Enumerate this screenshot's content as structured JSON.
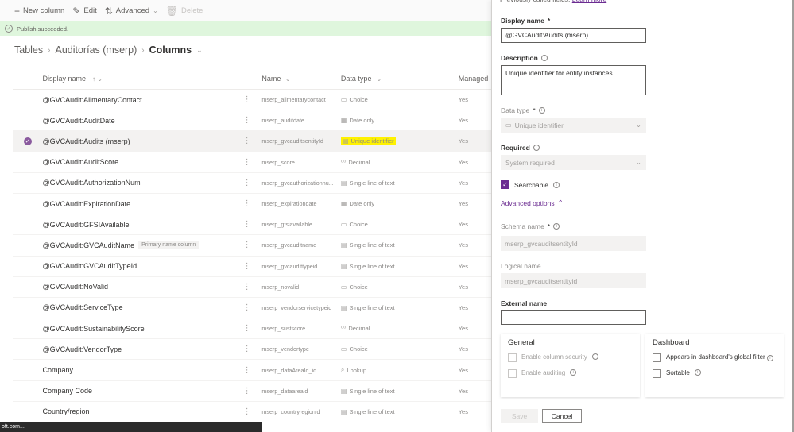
{
  "toolbar": {
    "new_column": "New column",
    "edit": "Edit",
    "advanced": "Advanced",
    "delete": "Delete"
  },
  "message": {
    "text": "Publish succeeded."
  },
  "breadcrumb": {
    "tables": "Tables",
    "table": "Auditorías (mserp)",
    "current": "Columns"
  },
  "grid": {
    "headers": {
      "display_name": "Display name",
      "name": "Name",
      "data_type": "Data type",
      "managed": "Managed"
    },
    "rows": [
      {
        "display": "@GVCAudit:AlimentaryContact",
        "name": "mserp_alimentarycontact",
        "type": "Choice",
        "type_icon": "choice-icon",
        "managed": "Yes"
      },
      {
        "display": "@GVCAudit:AuditDate",
        "name": "mserp_auditdate",
        "type": "Date only",
        "type_icon": "calendar-icon",
        "managed": "Yes"
      },
      {
        "display": "@GVCAudit:Audits (mserp)",
        "name": "mserp_gvcauditsentityId",
        "type": "Unique identifier",
        "type_icon": "id-icon",
        "managed": "Yes",
        "selected": true,
        "highlighted": true
      },
      {
        "display": "@GVCAudit:AuditScore",
        "name": "mserp_score",
        "type": "Decimal",
        "type_icon": "decimal-icon",
        "managed": "Yes"
      },
      {
        "display": "@GVCAudit:AuthorizationNum",
        "name": "mserp_gvcauthorizationnu...",
        "type": "Single line of text",
        "type_icon": "text-icon",
        "managed": "Yes"
      },
      {
        "display": "@GVCAudit:ExpirationDate",
        "name": "mserp_expirationdate",
        "type": "Date only",
        "type_icon": "calendar-icon",
        "managed": "Yes"
      },
      {
        "display": "@GVCAudit:GFSIAvailable",
        "name": "mserp_gfsiavailable",
        "type": "Choice",
        "type_icon": "choice-icon",
        "managed": "Yes"
      },
      {
        "display": "@GVCAudit:GVCAuditName",
        "badge": "Primary name column",
        "name": "mserp_gvcauditname",
        "type": "Single line of text",
        "type_icon": "text-icon",
        "managed": "Yes"
      },
      {
        "display": "@GVCAudit:GVCAuditTypeId",
        "name": "mserp_gvcaudittypeid",
        "type": "Single line of text",
        "type_icon": "text-icon",
        "managed": "Yes"
      },
      {
        "display": "@GVCAudit:NoValid",
        "name": "mserp_novalid",
        "type": "Choice",
        "type_icon": "choice-icon",
        "managed": "Yes"
      },
      {
        "display": "@GVCAudit:ServiceType",
        "name": "mserp_vendorservicetypeid",
        "type": "Single line of text",
        "type_icon": "text-icon",
        "managed": "Yes"
      },
      {
        "display": "@GVCAudit:SustainabilityScore",
        "name": "mserp_sustscore",
        "type": "Decimal",
        "type_icon": "decimal-icon",
        "managed": "Yes"
      },
      {
        "display": "@GVCAudit:VendorType",
        "name": "mserp_vendortype",
        "type": "Choice",
        "type_icon": "choice-icon",
        "managed": "Yes"
      },
      {
        "display": "Company",
        "name": "mserp_dataAreaId_id",
        "type": "Lookup",
        "type_icon": "lookup-icon",
        "managed": "Yes"
      },
      {
        "display": "Company Code",
        "name": "mserp_dataareaid",
        "type": "Single line of text",
        "type_icon": "text-icon",
        "managed": "Yes"
      },
      {
        "display": "Country/region",
        "name": "mserp_countryregionid",
        "type": "Single line of text",
        "type_icon": "text-icon",
        "managed": "Yes"
      }
    ]
  },
  "statusbar": {
    "text": "oft.com..."
  },
  "panel": {
    "cut_text": "Previously called fields.",
    "learn_more": "Learn more",
    "display_name_label": "Display name",
    "display_name_value": "@GVCAudit:Audits (mserp)",
    "description_label": "Description",
    "description_value": "Unique identifier for entity instances",
    "data_type_label": "Data type",
    "data_type_value": "Unique identifier",
    "required_label": "Required",
    "required_value": "System required",
    "searchable_label": "Searchable",
    "searchable_checked": true,
    "advanced_options": "Advanced options",
    "schema_name_label": "Schema name",
    "schema_name_value": "mserp_gvcauditsentityId",
    "logical_name_label": "Logical name",
    "logical_name_value": "mserp_gvcauditsentityid",
    "external_name_label": "External name",
    "external_name_value": "",
    "general": {
      "title": "General",
      "column_security": "Enable column security",
      "auditing": "Enable auditing"
    },
    "dashboard": {
      "title": "Dashboard",
      "global_filter": "Appears in dashboard's global filter",
      "sortable": "Sortable"
    },
    "save": "Save",
    "cancel": "Cancel",
    "required_star": "*"
  }
}
